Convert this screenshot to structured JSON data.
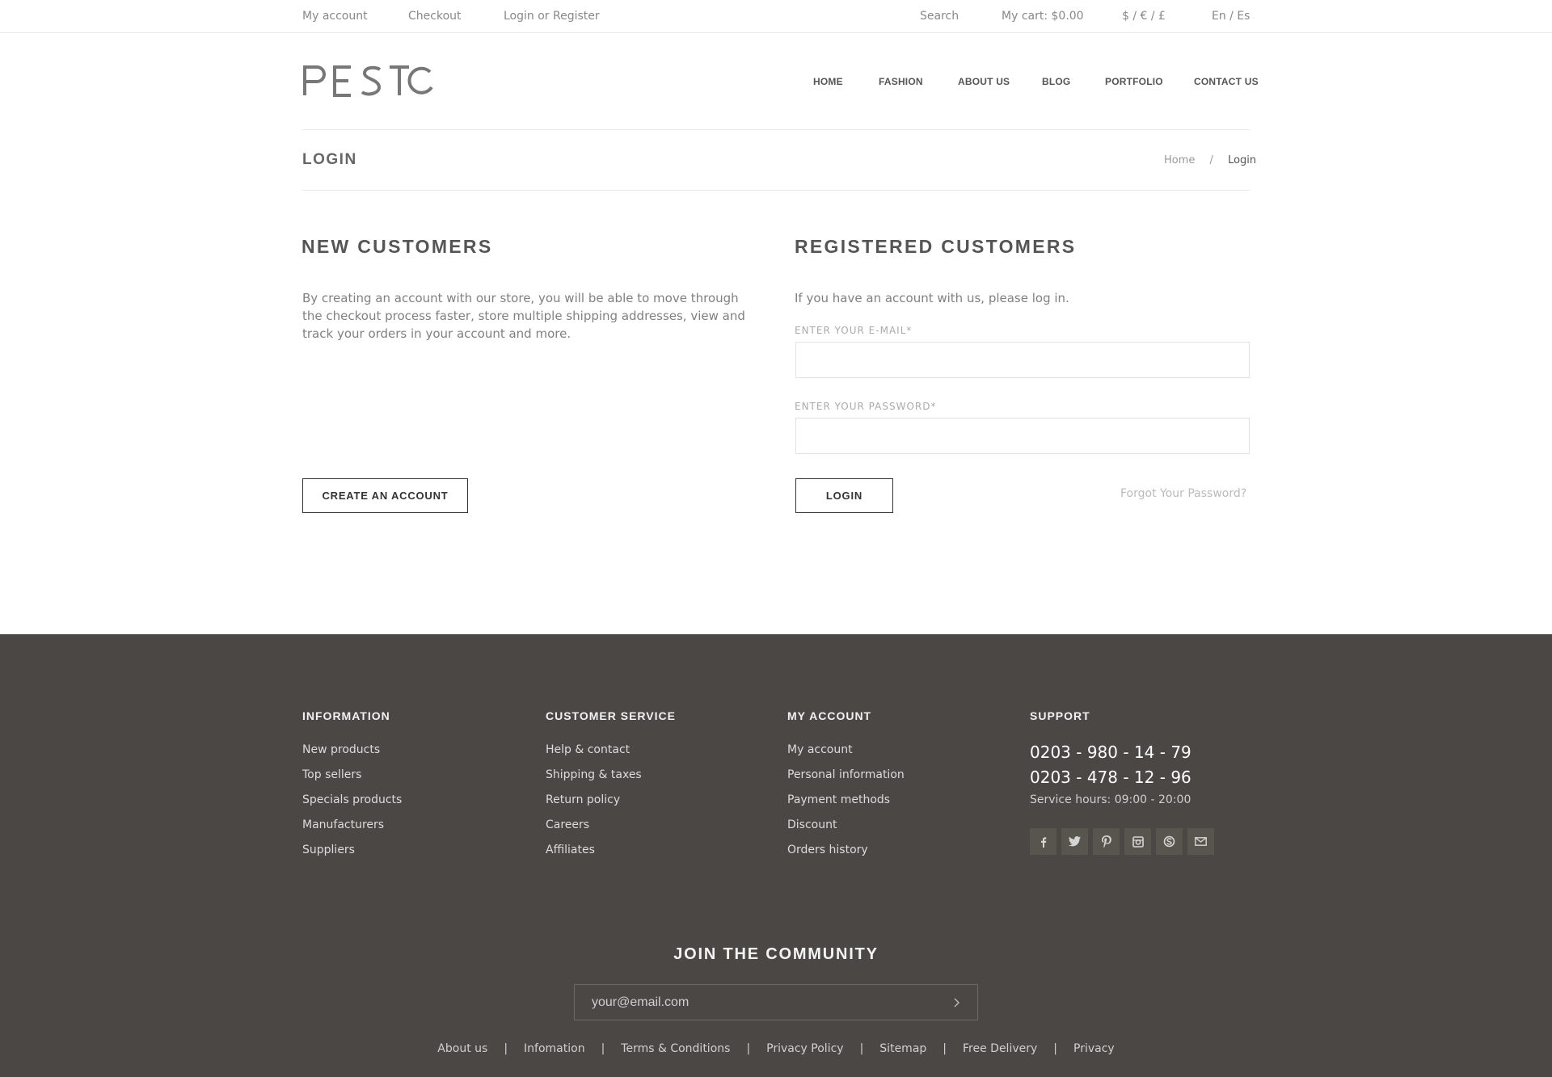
{
  "topbar": {
    "my_account": "My account",
    "checkout": "Checkout",
    "login_register": "Login or Register",
    "search": "Search",
    "cart": "My cart: $0.00",
    "currency": "$ / € / £",
    "language": "En / Es"
  },
  "brand": {
    "logo_text": "PESTO"
  },
  "nav": [
    "HOME",
    "FASHION",
    "ABOUT US",
    "BLOG",
    "PORTFOLIO",
    "CONTACT US"
  ],
  "page": {
    "title": "LOGIN",
    "breadcrumb": {
      "home": "Home",
      "separator": "/",
      "current": "Login"
    }
  },
  "new_customers": {
    "title": "NEW CUSTOMERS",
    "text": "By creating an account with our store, you will be able to move through the checkout process faster, store multiple shipping addresses, view and track your orders in your account and more.",
    "button": "CREATE AN ACCOUNT"
  },
  "registered": {
    "title": "REGISTERED CUSTOMERS",
    "text": "If you have an account with us, please log in.",
    "email_label": "ENTER YOUR E-MAIL*",
    "email_value": "",
    "password_label": "ENTER YOUR PASSWORD*",
    "password_value": "",
    "button": "LOGIN",
    "forgot": "Forgot Your Password?"
  },
  "footer": {
    "information": {
      "title": "INFORMATION",
      "links": [
        "New products",
        "Top sellers",
        "Specials products",
        "Manufacturers",
        "Suppliers"
      ]
    },
    "customer_service": {
      "title": "CUSTOMER SERVICE",
      "links": [
        "Help & contact",
        "Shipping & taxes",
        "Return policy",
        "Careers",
        "Affiliates"
      ]
    },
    "my_account": {
      "title": "MY ACCOUNT",
      "links": [
        "My account",
        "Personal information",
        "Payment methods",
        "Discount",
        "Orders history"
      ]
    },
    "support": {
      "title": "SUPPORT",
      "phone1": "0203 - 980 - 14 - 79",
      "phone2": "0203 - 478 - 12 - 96",
      "hours": "Service hours: 09:00 - 20:00",
      "social": [
        "facebook-icon",
        "twitter-icon",
        "pinterest-icon",
        "instagram-icon",
        "skype-icon",
        "mail-icon"
      ]
    },
    "join": {
      "title": "JOIN THE COMMUNITY",
      "placeholder": "your@email.com"
    },
    "bottom_links": [
      "About us",
      "Infomation",
      "Terms & Conditions",
      "Privacy Policy",
      "Sitemap",
      "Free Delivery",
      "Privacy"
    ],
    "bottom_separator": "|"
  }
}
